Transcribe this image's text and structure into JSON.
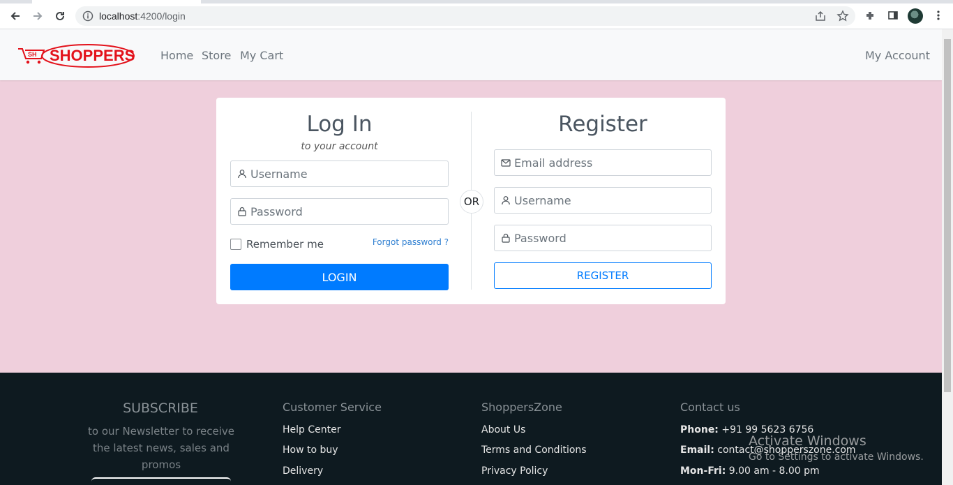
{
  "browser": {
    "url_host": "localhost",
    "url_rest": ":4200/login"
  },
  "navbar": {
    "brand_text": "SHOPPERS",
    "brand_badge": "SH",
    "links": [
      "Home",
      "Store",
      "My Cart"
    ],
    "account": "My Account"
  },
  "login": {
    "title": "Log In",
    "subtitle": "to your account",
    "username_placeholder": "Username",
    "password_placeholder": "Password",
    "remember_label": "Remember me",
    "forgot_label": "Forgot password ?",
    "button_label": "LOGIN"
  },
  "or_label": "OR",
  "register": {
    "title": "Register",
    "email_placeholder": "Email address",
    "username_placeholder": "Username",
    "password_placeholder": "Password",
    "button_label": "REGISTER"
  },
  "footer": {
    "subscribe_title": "SUBSCRIBE",
    "subscribe_text": "to our Newsletter to receive the latest news, sales and promos",
    "customer_service": {
      "title": "Customer Service",
      "links": [
        "Help Center",
        "How to buy",
        "Delivery"
      ]
    },
    "shopperszone": {
      "title": "ShoppersZone",
      "links": [
        "About Us",
        "Terms and Conditions",
        "Privacy Policy"
      ]
    },
    "contact": {
      "title": "Contact us",
      "phone_label": "Phone:",
      "phone_value": "+91 99 5623 6756",
      "email_label": "Email:",
      "email_value": "contact@shopperszone.com",
      "hours_label": "Mon-Fri:",
      "hours_value": "9.00 am - 8.00 pm"
    }
  },
  "watermark": {
    "line1": "Activate Windows",
    "line2": "Go to Settings to activate Windows."
  },
  "colors": {
    "page_bg": "#efcfdc",
    "primary": "#007bff",
    "brand_red": "#e3121b",
    "footer_bg": "#0e1a20"
  }
}
